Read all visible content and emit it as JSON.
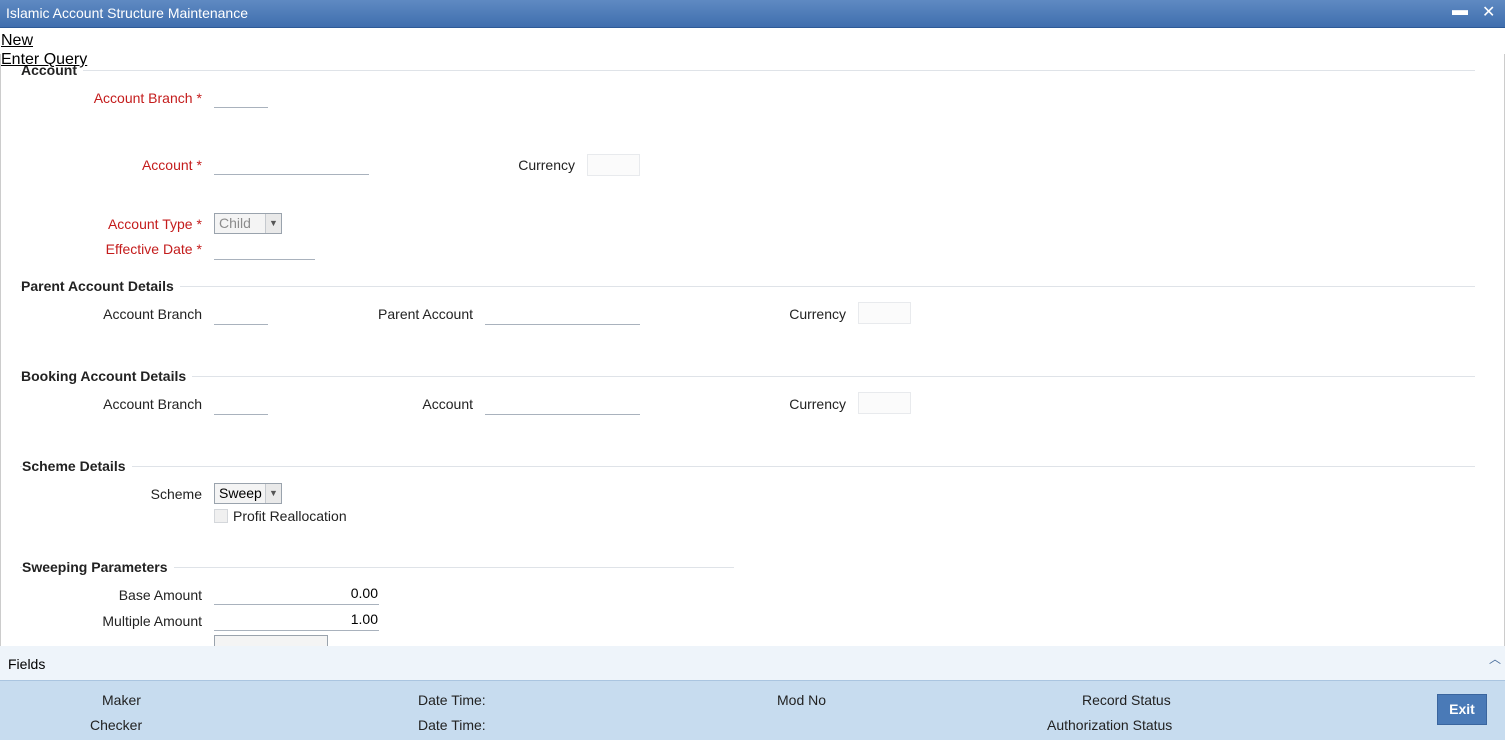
{
  "window": {
    "title": "Islamic Account Structure Maintenance",
    "minimize_glyph": "▬",
    "close_glyph": "✕"
  },
  "menu": {
    "new_label": "New",
    "enter_query_label": "Enter Query"
  },
  "account_section": {
    "title": "Account",
    "account_branch_label": "Account Branch",
    "account_label": "Account",
    "currency_label": "Currency",
    "account_type_label": "Account Type",
    "account_type_value": "Child",
    "effective_date_label": "Effective Date",
    "required_mark": "*"
  },
  "parent_section": {
    "title": "Parent Account Details",
    "account_branch_label": "Account Branch",
    "parent_account_label": "Parent Account",
    "currency_label": "Currency"
  },
  "booking_section": {
    "title": "Booking Account Details",
    "account_branch_label": "Account Branch",
    "account_label": "Account",
    "currency_label": "Currency"
  },
  "scheme_section": {
    "title": "Scheme Details",
    "scheme_label": "Scheme",
    "scheme_value": "Sweep",
    "profit_reallocation_label": "Profit Reallocation",
    "profit_reallocation_checked": false
  },
  "sweeping_section": {
    "title": "Sweeping Parameters",
    "base_amount_label": "Base Amount",
    "base_amount_value": "0.00",
    "multiple_amount_label": "Multiple Amount",
    "multiple_amount_value": "1.00"
  },
  "fields_bar": {
    "label": "Fields",
    "collapse_glyph": "︿"
  },
  "footer": {
    "maker_label": "Maker",
    "checker_label": "Checker",
    "date_time_label_1": "Date Time:",
    "date_time_label_2": "Date Time:",
    "mod_no_label": "Mod No",
    "record_status_label": "Record Status",
    "authorization_status_label": "Authorization Status",
    "exit_label": "Exit"
  },
  "colors": {
    "title_bar": "#3f6eae",
    "required_label": "#c41c1c",
    "footer_bg": "#c7dcef",
    "exit_button": "#4a7ab7"
  }
}
